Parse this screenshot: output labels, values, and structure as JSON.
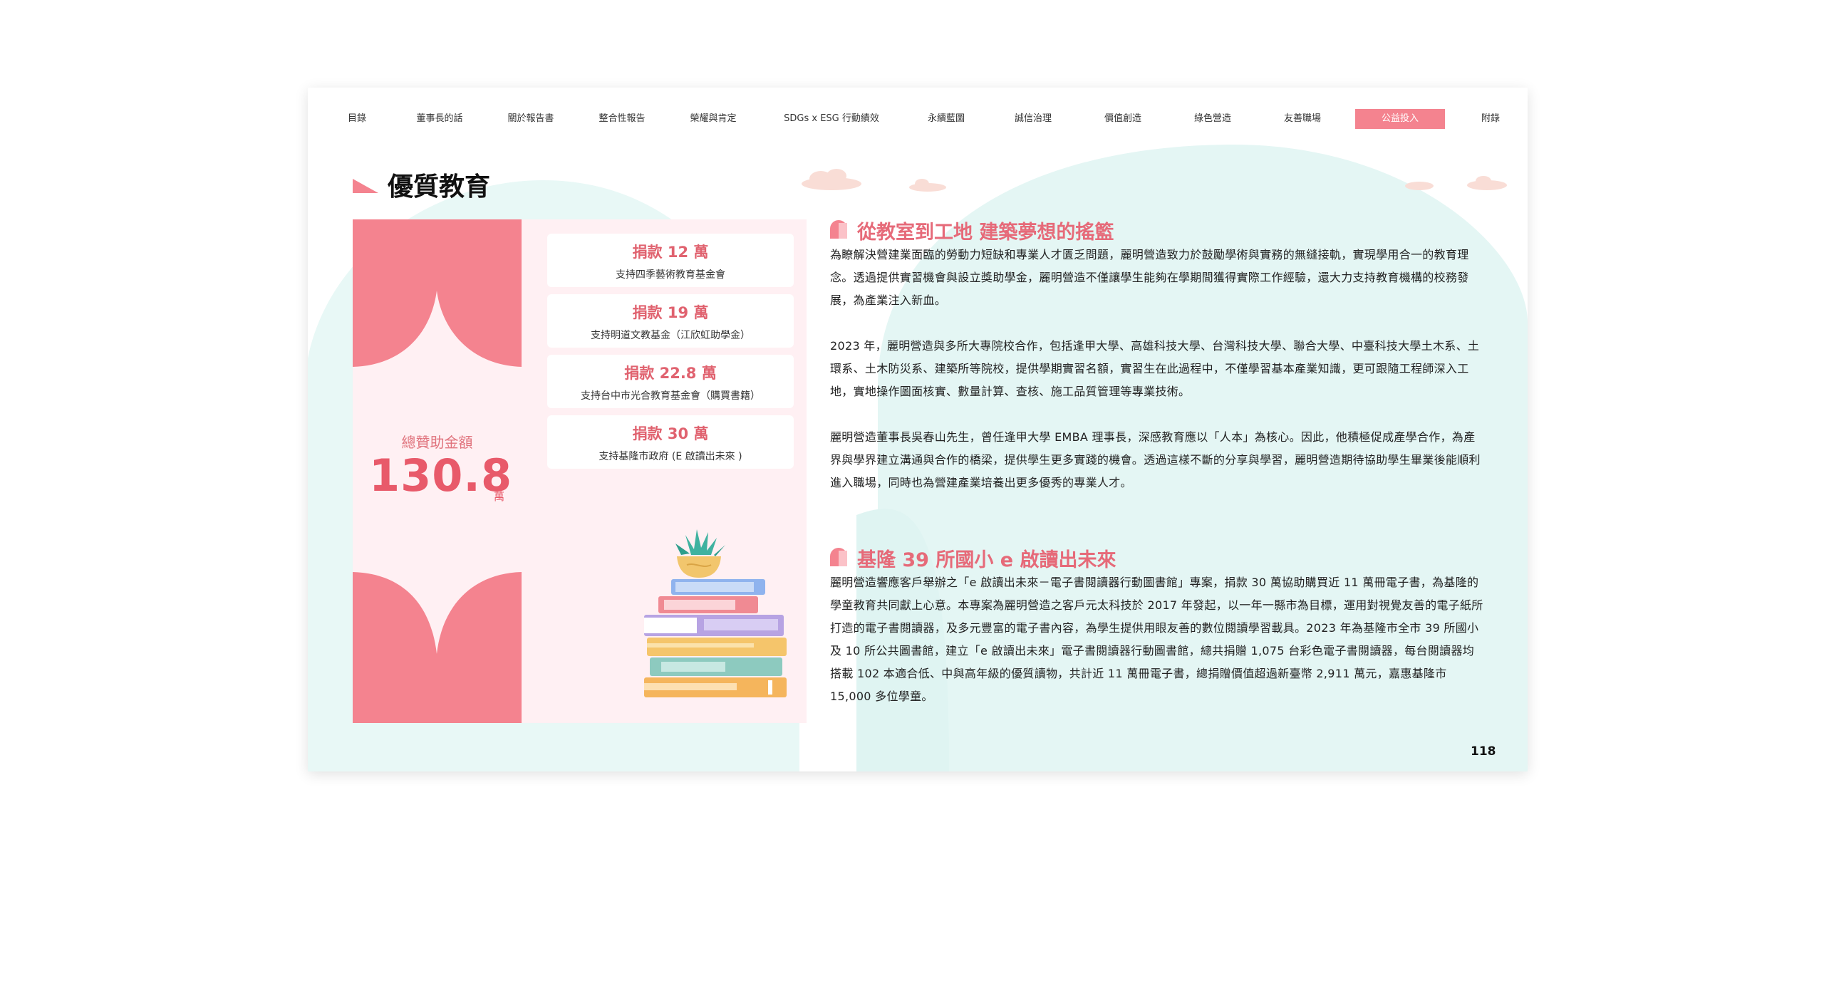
{
  "nav": {
    "items": [
      {
        "label": "目錄",
        "active": false
      },
      {
        "label": "董事長的話",
        "active": false
      },
      {
        "label": "關於報告書",
        "active": false
      },
      {
        "label": "整合性報告",
        "active": false
      },
      {
        "label": "榮耀與肯定",
        "active": false
      },
      {
        "label": "SDGs x ESG 行動績效",
        "active": false
      },
      {
        "label": "永續藍圖",
        "active": false
      },
      {
        "label": "誠信治理",
        "active": false
      },
      {
        "label": "價值創造",
        "active": false
      },
      {
        "label": "綠色營造",
        "active": false
      },
      {
        "label": "友善職場",
        "active": false
      },
      {
        "label": "公益投入",
        "active": true
      },
      {
        "label": "附錄",
        "active": false
      }
    ]
  },
  "section": {
    "title": "優質教育"
  },
  "summary": {
    "total_label": "總贊助金額",
    "total_value": "130.8",
    "total_unit": "萬"
  },
  "donations": [
    {
      "amount": "捐款 12 萬",
      "desc": "支持四季藝術教育基金會"
    },
    {
      "amount": "捐款 19 萬",
      "desc": "支持明道文教基金（江欣虹助學金）"
    },
    {
      "amount": "捐款 22.8 萬",
      "desc": "支持台中市光合教育基金會（購買書籍）"
    },
    {
      "amount": "捐款 30 萬",
      "desc": "支持基隆市政府 (E 啟讀出未來 )"
    }
  ],
  "article1": {
    "title": "從教室到工地 建築夢想的搖籃",
    "paragraphs": [
      "為瞭解決營建業面臨的勞動力短缺和專業人才匱乏問題，麗明營造致力於鼓勵學術與實務的無縫接軌，實現學用合一的教育理念。透過提供實習機會與設立獎助學金，麗明營造不僅讓學生能夠在學期間獲得實際工作經驗，還大力支持教育機構的校務發展，為產業注入新血。",
      "2023 年，麗明營造與多所大專院校合作，包括逢甲大學、高雄科技大學、台灣科技大學、聯合大學、中臺科技大學土木系、土環系、土木防災系、建築所等院校，提供學期實習名額，實習生在此過程中，不僅學習基本產業知識，更可跟隨工程師深入工地，實地操作圖面核實、數量計算、查核、施工品質管理等專業技術。",
      "麗明營造董事長吳春山先生，曾任逢甲大學 EMBA 理事長，深感教育應以「人本」為核心。因此，他積極促成產學合作，為產界與學界建立溝通與合作的橋梁，提供學生更多實踐的機會。透過這樣不斷的分享與學習，麗明營造期待協助學生畢業後能順利進入職場，同時也為營建產業培養出更多優秀的專業人才。"
    ]
  },
  "article2": {
    "title": "基隆 39 所國小 e 啟讀出未來",
    "paragraphs": [
      "麗明營造響應客戶舉辦之「e 啟讀出未來－電子書閱讀器行動圖書館」專案，捐款 30 萬協助購買近 11 萬冊電子書，為基隆的學童教育共同獻上心意。本專案為麗明營造之客戶元太科技於 2017 年發起，以一年一縣市為目標，運用對視覺友善的電子紙所打造的電子書閱讀器，及多元豐富的電子書內容，為學生提供用眼友善的數位閱讀學習載具。2023 年為基隆市全市 39 所國小及 10 所公共圖書館，建立「e 啟讀出未來」電子書閱讀器行動圖書館，總共捐贈 1,075 台彩色電子書閱讀器，每台閱讀器均搭載 102 本適合低、中與高年級的優質讀物，共計近 11 萬冊電子書，總捐贈價值超過新臺幣 2,911 萬元，嘉惠基隆市 15,000 多位學童。"
    ]
  },
  "page_number": "118",
  "colors": {
    "accent": "#f4838f",
    "title_pink": "#e66a79",
    "bg_mint": "#e6f7f5"
  }
}
